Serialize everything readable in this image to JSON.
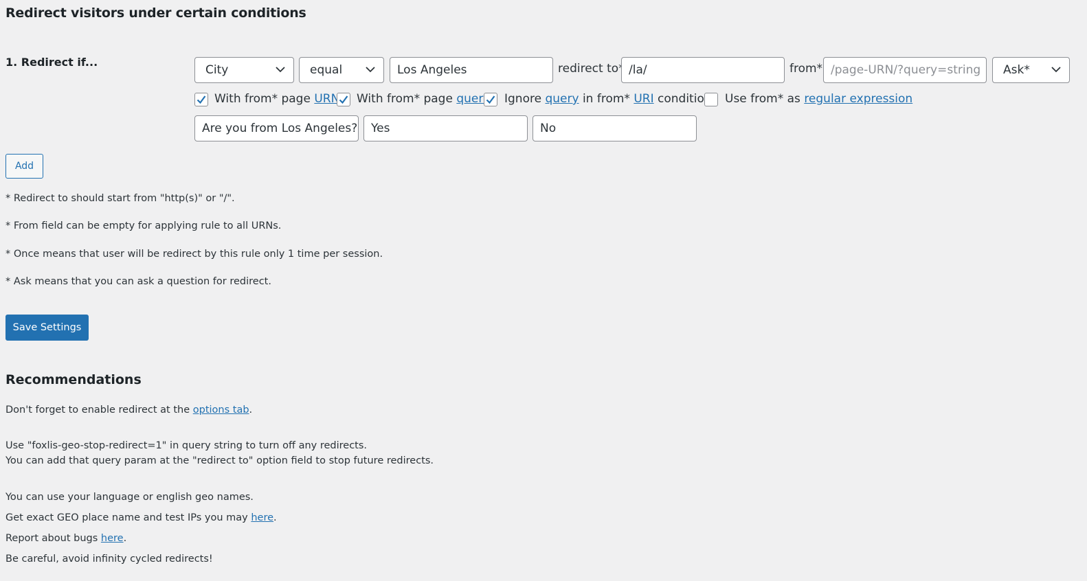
{
  "page": {
    "title": "Redirect visitors under certain conditions"
  },
  "rule": {
    "label": "1. Redirect if...",
    "condition_type": "City",
    "operator": "equal",
    "value": "Los Angeles",
    "redirect_to_label": "redirect to*",
    "redirect_to_value": "/la/",
    "from_label": "from*",
    "from_placeholder": "/page-URN/?query=string",
    "mode": "Ask*",
    "checkboxes": {
      "with_page_urn": {
        "checked": true,
        "prefix": "With from* page",
        "link": "URN"
      },
      "with_page_query": {
        "checked": true,
        "prefix": "With from* page",
        "link": "query"
      },
      "ignore_query": {
        "checked": true,
        "prefix": "Ignore",
        "link1": "query",
        "middle": "in from*",
        "link2": "URI",
        "suffix": "conditions"
      },
      "use_regex": {
        "checked": false,
        "prefix": "Use from* as",
        "link": "regular expression"
      }
    },
    "question": "Are you from Los Angeles?",
    "yes_answer": "Yes",
    "no_answer": "No"
  },
  "buttons": {
    "add": "Add",
    "save": "Save Settings"
  },
  "notes": [
    "* Redirect to should start from \"http(s)\" or \"/\".",
    "* From field can be empty for applying rule to all URNs.",
    "* Once means that user will be redirect by this rule only 1 time per session.",
    "* Ask means that you can ask a question for redirect."
  ],
  "recommendations": {
    "heading": "Recommendations",
    "enable_prefix": "Don't forget to enable redirect at the",
    "enable_link": "options tab",
    "enable_suffix": ".",
    "stop_line1": "Use \"foxlis-geo-stop-redirect=1\" in query string to turn off any redirects.",
    "stop_line2": "You can add that query param at the \"redirect to\" option field to stop future redirects.",
    "language": "You can use your language or english geo names.",
    "geo_prefix": "Get exact GEO place name and test IPs you may",
    "geo_link": "here",
    "geo_suffix": ".",
    "bugs_prefix": "Report about bugs",
    "bugs_link": "here",
    "bugs_suffix": ".",
    "careful": "Be careful, avoid infinity cycled redirects!"
  },
  "colors": {
    "background": "#f0f0f1",
    "accent": "#2271b1",
    "border": "#8c8f94"
  }
}
